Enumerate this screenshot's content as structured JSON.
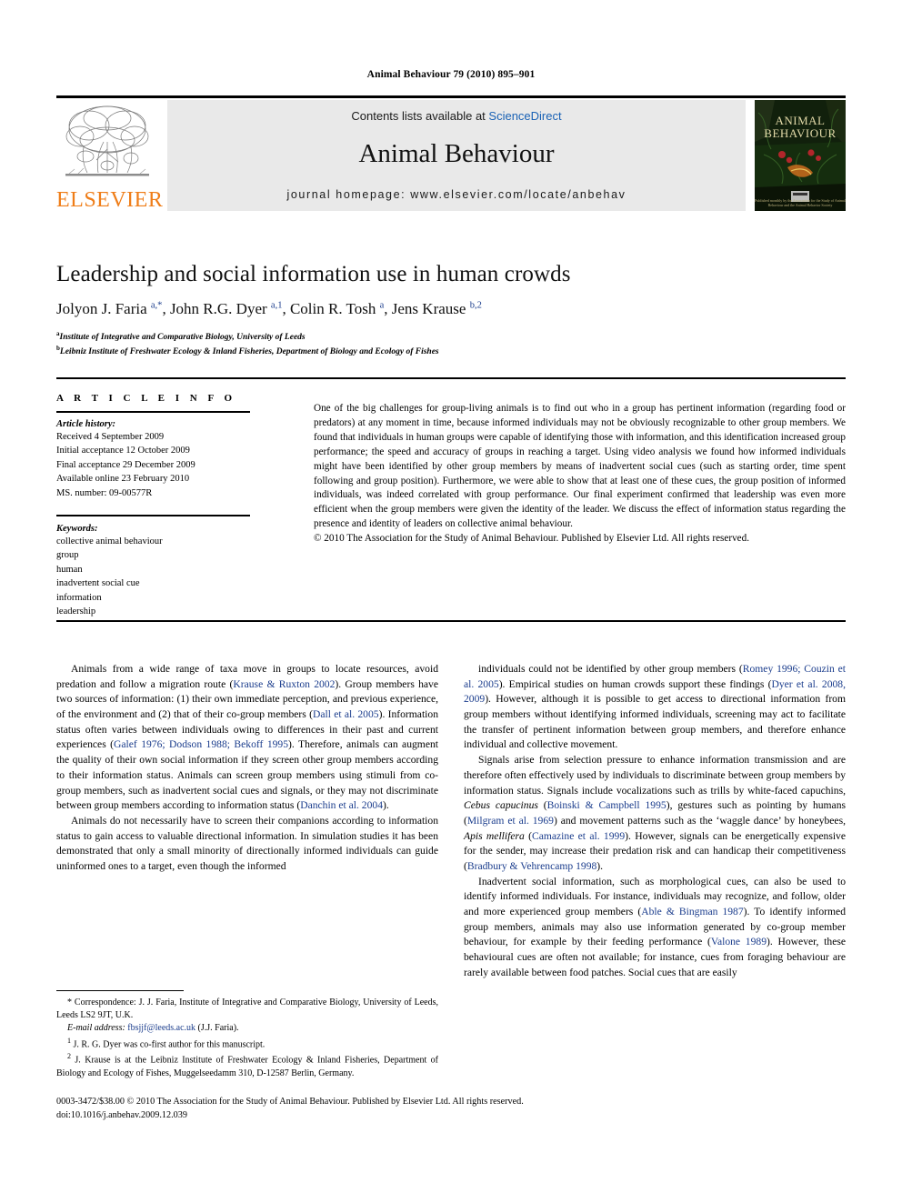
{
  "running_head": "Animal Behaviour 79 (2010) 895–901",
  "masthead": {
    "contents_prefix": "Contents lists available at ",
    "sciencedirect": "ScienceDirect",
    "journal_name": "Animal Behaviour",
    "homepage": "journal homepage: www.elsevier.com/locate/anbehav",
    "publisher_logo_text": "ELSEVIER",
    "cover_title_line1": "ANIMAL",
    "cover_title_line2": "BEHAVIOUR",
    "cover_footer": "Published monthly by the Association for the Study of Animal Behaviour and the Animal Behavior Society"
  },
  "article": {
    "title": "Leadership and social information use in human crowds",
    "authors_html": "Jolyon J. Faria <sup>a,*</sup>, John R.G. Dyer <sup>a,1</sup>, Colin R. Tosh <sup>a</sup>, Jens Krause <sup>b,2</sup>",
    "affiliation_a": "Institute of Integrative and Comparative Biology, University of Leeds",
    "affiliation_b": "Leibniz Institute of Freshwater Ecology & Inland Fisheries, Department of Biology and Ecology of Fishes"
  },
  "article_info": {
    "heading": "A R T I C L E  I N F O",
    "history_label": "Article history:",
    "history": [
      "Received 4 September 2009",
      "Initial acceptance 12 October 2009",
      "Final acceptance 29 December 2009",
      "Available online 23 February 2010",
      "MS. number: 09-00577R"
    ],
    "keywords_label": "Keywords:",
    "keywords": [
      "collective animal behaviour",
      "group",
      "human",
      "inadvertent social cue",
      "information",
      "leadership"
    ]
  },
  "abstract": {
    "text": "One of the big challenges for group-living animals is to find out who in a group has pertinent information (regarding food or predators) at any moment in time, because informed individuals may not be obviously recognizable to other group members. We found that individuals in human groups were capable of identifying those with information, and this identification increased group performance; the speed and accuracy of groups in reaching a target. Using video analysis we found how informed individuals might have been identified by other group members by means of inadvertent social cues (such as starting order, time spent following and group position). Furthermore, we were able to show that at least one of these cues, the group position of informed individuals, was indeed correlated with group performance. Our final experiment confirmed that leadership was even more efficient when the group members were given the identity of the leader. We discuss the effect of information status regarding the presence and identity of leaders on collective animal behaviour.",
    "copyright": "© 2010 The Association for the Study of Animal Behaviour. Published by Elsevier Ltd. All rights reserved."
  },
  "body": {
    "left_paragraphs_html": [
      "Animals from a wide range of taxa move in groups to locate resources, avoid predation and follow a migration route (<span class=\"ref\">Krause &amp; Ruxton 2002</span>). Group members have two sources of information: (1) their own immediate perception, and previous experience, of the environment and (2) that of their co-group members (<span class=\"ref\">Dall et al. 2005</span>). Information status often varies between individuals owing to differences in their past and current experiences (<span class=\"ref\">Galef 1976; Dodson 1988; Bekoff 1995</span>). Therefore, animals can augment the quality of their own social information if they screen other group members according to their information status. Animals can screen group members using stimuli from co-group members, such as inadvertent social cues and signals, or they may not discriminate between group members according to information status (<span class=\"ref\">Danchin et al. 2004</span>).",
      "Animals do not necessarily have to screen their companions according to information status to gain access to valuable directional information. In simulation studies it has been demonstrated that only a small minority of directionally informed individuals can guide uninformed ones to a target, even though the informed"
    ],
    "right_paragraphs_html": [
      "individuals could not be identified by other group members (<span class=\"ref\">Romey 1996; Couzin et al. 2005</span>). Empirical studies on human crowds support these findings (<span class=\"ref\">Dyer et al. 2008, 2009</span>). However, although it is possible to get access to directional information from group members without identifying informed individuals, screening may act to facilitate the transfer of pertinent information between group members, and therefore enhance individual and collective movement.",
      "Signals arise from selection pressure to enhance information transmission and are therefore often effectively used by individuals to discriminate between group members by information status. Signals include vocalizations such as trills by white-faced capuchins, <span class=\"sp\">Cebus capucinus</span> (<span class=\"ref\">Boinski &amp; Campbell 1995</span>), gestures such as pointing by humans (<span class=\"ref\">Milgram et al. 1969</span>) and movement patterns such as the ‘waggle dance’ by honeybees, <span class=\"sp\">Apis mellifera</span> (<span class=\"ref\">Camazine et al. 1999</span>). However, signals can be energetically expensive for the sender, may increase their predation risk and can handicap their competitiveness (<span class=\"ref\">Bradbury &amp; Vehrencamp 1998</span>).",
      "Inadvertent social information, such as morphological cues, can also be used to identify informed individuals. For instance, individuals may recognize, and follow, older and more experienced group members (<span class=\"ref\">Able &amp; Bingman 1987</span>). To identify informed group members, animals may also use information generated by co-group member behaviour, for example by their feeding performance (<span class=\"ref\">Valone 1989</span>). However, these behavioural cues are often not available; for instance, cues from foraging behaviour are rarely available between food patches. Social cues that are easily"
    ]
  },
  "footnotes": {
    "correspondence_html": "* Correspondence: J. J. Faria, Institute of Integrative and Comparative Biology, University of Leeds, Leeds LS2 9JT, U.K.",
    "email_label": "E-mail address:",
    "email": "fbsjjf@leeds.ac.uk",
    "email_suffix": "(J.J. Faria).",
    "note1_html": "<sup>1</sup> J. R. G. Dyer was co-first author for this manuscript.",
    "note2_html": "<sup>2</sup> J. Krause is at the Leibniz Institute of Freshwater Ecology &amp; Inland Fisheries, Department of Biology and Ecology of Fishes, Muggelseedamm 310, D-12587 Berlin, Germany."
  },
  "imprint": {
    "line1": "0003-3472/$38.00 © 2010 The Association for the Study of Animal Behaviour. Published by Elsevier Ltd. All rights reserved.",
    "line2": "doi:10.1016/j.anbehav.2009.12.039"
  },
  "colors": {
    "link_blue": "#1a62b5",
    "reference_blue": "#1a3c8c",
    "elsevier_orange": "#ef7d18",
    "masthead_grey": "#e9e9e9"
  }
}
